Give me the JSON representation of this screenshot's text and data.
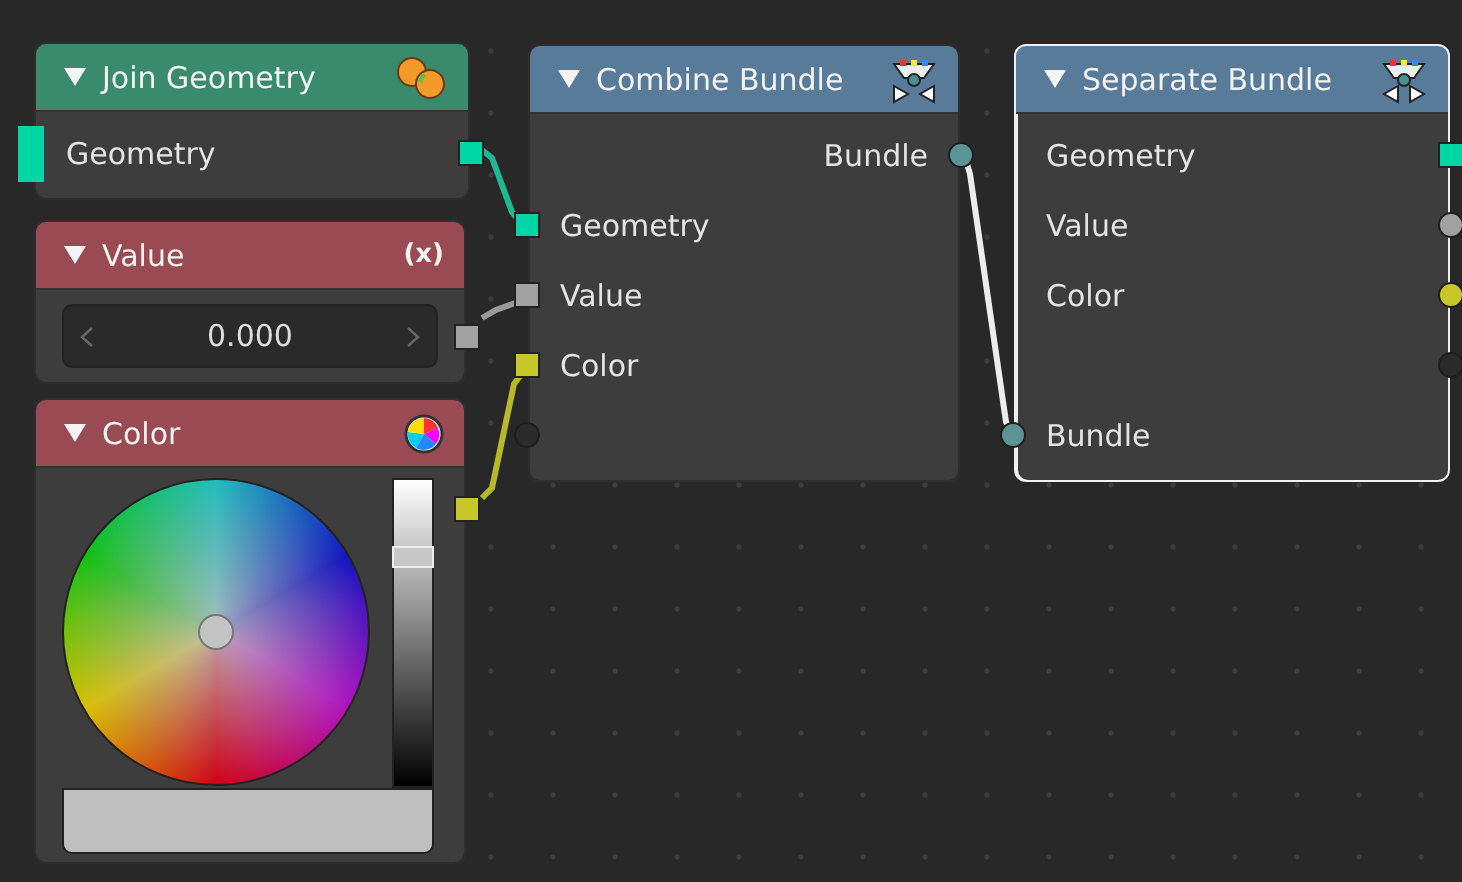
{
  "nodes": [
    {
      "kind": "join",
      "title": "Join Geometry",
      "color": "#3a8a6e",
      "selected": false,
      "rows": [
        {
          "label": "Geometry",
          "input": {
            "kind": "bar",
            "color": "#00d6a3"
          },
          "output": {
            "kind": "square",
            "color": "#00d6a3"
          }
        }
      ]
    },
    {
      "kind": "value",
      "title": "Value",
      "color": "#9a4a52",
      "badge": "(x)",
      "selected": false,
      "value": "0.000",
      "output": {
        "kind": "square",
        "color": "#a1a1a1"
      }
    },
    {
      "kind": "color",
      "title": "Color",
      "color": "#9a4a52",
      "selected": false,
      "level": 0.77,
      "output": {
        "kind": "square",
        "color": "#c7c729"
      }
    },
    {
      "kind": "combine",
      "title": "Combine Bundle",
      "color": "#587b9a",
      "selected": false,
      "rows": [
        {
          "label": "Bundle",
          "output": {
            "kind": "circle",
            "color": "#5a9494"
          }
        },
        {
          "label": "Geometry",
          "input": {
            "kind": "square",
            "color": "#00d6a3"
          }
        },
        {
          "label": "Value",
          "input": {
            "kind": "square",
            "color": "#a1a1a1"
          }
        },
        {
          "label": "Color",
          "input": {
            "kind": "square",
            "color": "#c7c729"
          }
        },
        {
          "input": {
            "kind": "circle",
            "color": "#2a2a2a"
          }
        }
      ]
    },
    {
      "kind": "separate",
      "title": "Separate Bundle",
      "color": "#587b9a",
      "selected": true,
      "rows": [
        {
          "label": "Geometry",
          "output": {
            "kind": "square",
            "color": "#00d6a3"
          }
        },
        {
          "label": "Value",
          "output": {
            "kind": "circle",
            "color": "#a1a1a1"
          }
        },
        {
          "label": "Color",
          "output": {
            "kind": "circle",
            "color": "#c7c729"
          }
        },
        {
          "output": {
            "kind": "circle",
            "color": "#2a2a2a"
          }
        },
        {
          "label": "Bundle",
          "input": {
            "kind": "circle",
            "color": "#5a9494"
          }
        }
      ]
    }
  ]
}
